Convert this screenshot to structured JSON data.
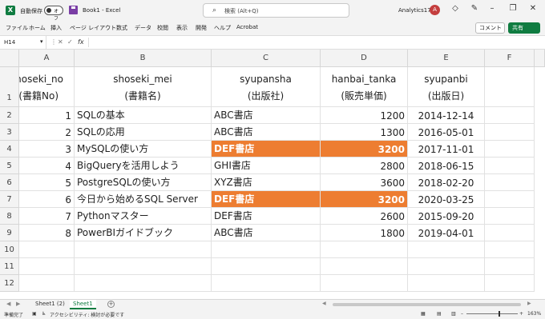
{
  "titlebar": {
    "logo_letter": "X",
    "autosave_label": "自動保存",
    "autosave_state": "オフ",
    "doc_title": "Book1 - Excel",
    "search_placeholder": "検索 (Alt+Q)",
    "account_name": "Analytics17",
    "avatar_letter": "A"
  },
  "ribbon": {
    "tabs": [
      "ファイル",
      "ホーム",
      "挿入",
      "ページ レイアウト",
      "数式",
      "データ",
      "校閲",
      "表示",
      "開発",
      "ヘルプ",
      "Acrobat"
    ],
    "comment_label": "コメント",
    "share_label": "共有"
  },
  "formula_bar": {
    "name_box": "H14",
    "fx_symbol": "fx",
    "formula": ""
  },
  "grid": {
    "columns": [
      "A",
      "B",
      "C",
      "D",
      "E",
      "F"
    ],
    "rows": [
      "1",
      "2",
      "3",
      "4",
      "5",
      "6",
      "7",
      "8",
      "9",
      "10",
      "11",
      "12"
    ],
    "header_row": [
      {
        "line1": "shoseki_no",
        "line2": "(書籍No)"
      },
      {
        "line1": "shoseki_mei",
        "line2": "(書籍名)"
      },
      {
        "line1": "syupansha",
        "line2": "(出版社)"
      },
      {
        "line1": "hanbai_tanka",
        "line2": "(販売単価)"
      },
      {
        "line1": "syupanbi",
        "line2": "(出版日)"
      }
    ],
    "data_rows": [
      {
        "no": "1",
        "name": "SQLの基本",
        "publisher": "ABC書店",
        "price": "1200",
        "date": "2014-12-14",
        "highlight": false
      },
      {
        "no": "2",
        "name": "SQLの応用",
        "publisher": "ABC書店",
        "price": "1300",
        "date": "2016-05-01",
        "highlight": false
      },
      {
        "no": "3",
        "name": "MySQLの使い方",
        "publisher": "DEF書店",
        "price": "3200",
        "date": "2017-11-01",
        "highlight": true
      },
      {
        "no": "4",
        "name": "BigQueryを活用しよう",
        "publisher": "GHI書店",
        "price": "2800",
        "date": "2018-06-15",
        "highlight": false
      },
      {
        "no": "5",
        "name": "PostgreSQLの使い方",
        "publisher": "XYZ書店",
        "price": "3600",
        "date": "2018-02-20",
        "highlight": false
      },
      {
        "no": "6",
        "name": "今日から始めるSQL Server",
        "publisher": "DEF書店",
        "price": "3200",
        "date": "2020-03-25",
        "highlight": true
      },
      {
        "no": "7",
        "name": "Pythonマスター",
        "publisher": "DEF書店",
        "price": "2600",
        "date": "2015-09-20",
        "highlight": false
      },
      {
        "no": "8",
        "name": "PowerBIガイドブック",
        "publisher": "ABC書店",
        "price": "1800",
        "date": "2019-04-01",
        "highlight": false
      }
    ],
    "highlight_color": "#ed7d31"
  },
  "sheets": {
    "tabs": [
      {
        "label": "Sheet1 (2)",
        "active": false
      },
      {
        "label": "Sheet1",
        "active": true
      }
    ]
  },
  "statusbar": {
    "ready": "準備完了",
    "accessibility": "アクセシビリティ: 検討が必要です",
    "zoom": "163%"
  }
}
